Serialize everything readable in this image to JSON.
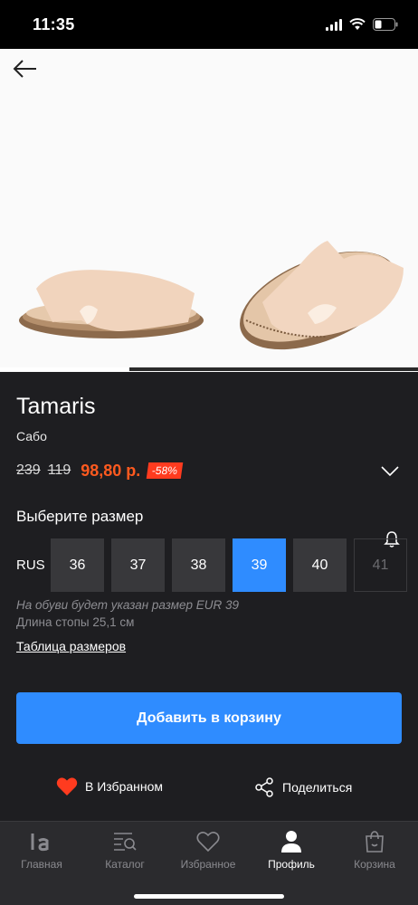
{
  "status": {
    "time": "11:35"
  },
  "photo": {
    "progress": 0.31
  },
  "product": {
    "brand": "Tamaris",
    "category": "Сабо",
    "old_price_1": "239",
    "old_price_2": "119",
    "price": "98,80 р.",
    "discount": "-58%"
  },
  "sizes": {
    "title": "Выберите размер",
    "system": "RUS",
    "options": [
      "36",
      "37",
      "38",
      "39",
      "40",
      "41"
    ],
    "selected": "39",
    "unavailable": [
      "41"
    ],
    "note": "На обуви будет указан размер EUR 39",
    "foot_length": "Длина стопы 25,1 см",
    "table_link": "Таблица размеров"
  },
  "actions": {
    "add_to_cart": "Добавить в корзину",
    "favorite": "В Избранном",
    "share": "Поделиться"
  },
  "tabbar": {
    "items": [
      {
        "label": "Главная",
        "icon": "lamoda-logo-icon"
      },
      {
        "label": "Каталог",
        "icon": "catalog-search-icon"
      },
      {
        "label": "Избранное",
        "icon": "heart-outline-icon"
      },
      {
        "label": "Профиль",
        "icon": "profile-icon"
      },
      {
        "label": "Корзина",
        "icon": "shopping-bag-icon"
      }
    ],
    "active": "Профиль"
  },
  "colors": {
    "accent": "#2f8cff",
    "sale": "#ff5a1f",
    "heart": "#ff3b1f"
  }
}
